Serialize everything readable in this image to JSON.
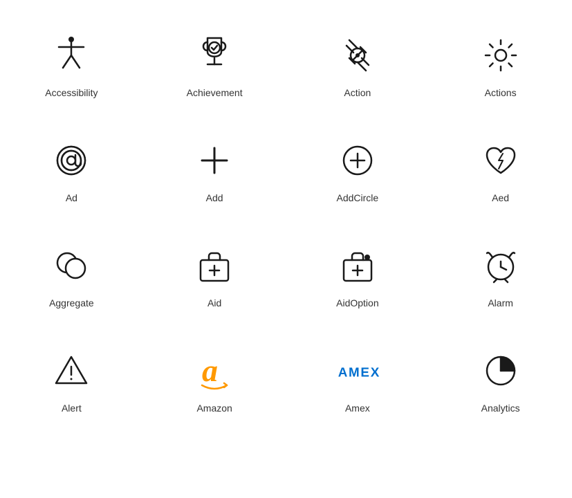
{
  "icons": [
    {
      "id": "accessibility",
      "label": "Accessibility"
    },
    {
      "id": "achievement",
      "label": "Achievement"
    },
    {
      "id": "action",
      "label": "Action"
    },
    {
      "id": "actions",
      "label": "Actions"
    },
    {
      "id": "ad",
      "label": "Ad"
    },
    {
      "id": "add",
      "label": "Add"
    },
    {
      "id": "add-circle",
      "label": "AddCircle"
    },
    {
      "id": "aed",
      "label": "Aed"
    },
    {
      "id": "aggregate",
      "label": "Aggregate"
    },
    {
      "id": "aid",
      "label": "Aid"
    },
    {
      "id": "aid-option",
      "label": "AidOption"
    },
    {
      "id": "alarm",
      "label": "Alarm"
    },
    {
      "id": "alert",
      "label": "Alert"
    },
    {
      "id": "amazon",
      "label": "Amazon"
    },
    {
      "id": "amex",
      "label": "Amex"
    },
    {
      "id": "analytics",
      "label": "Analytics"
    }
  ]
}
